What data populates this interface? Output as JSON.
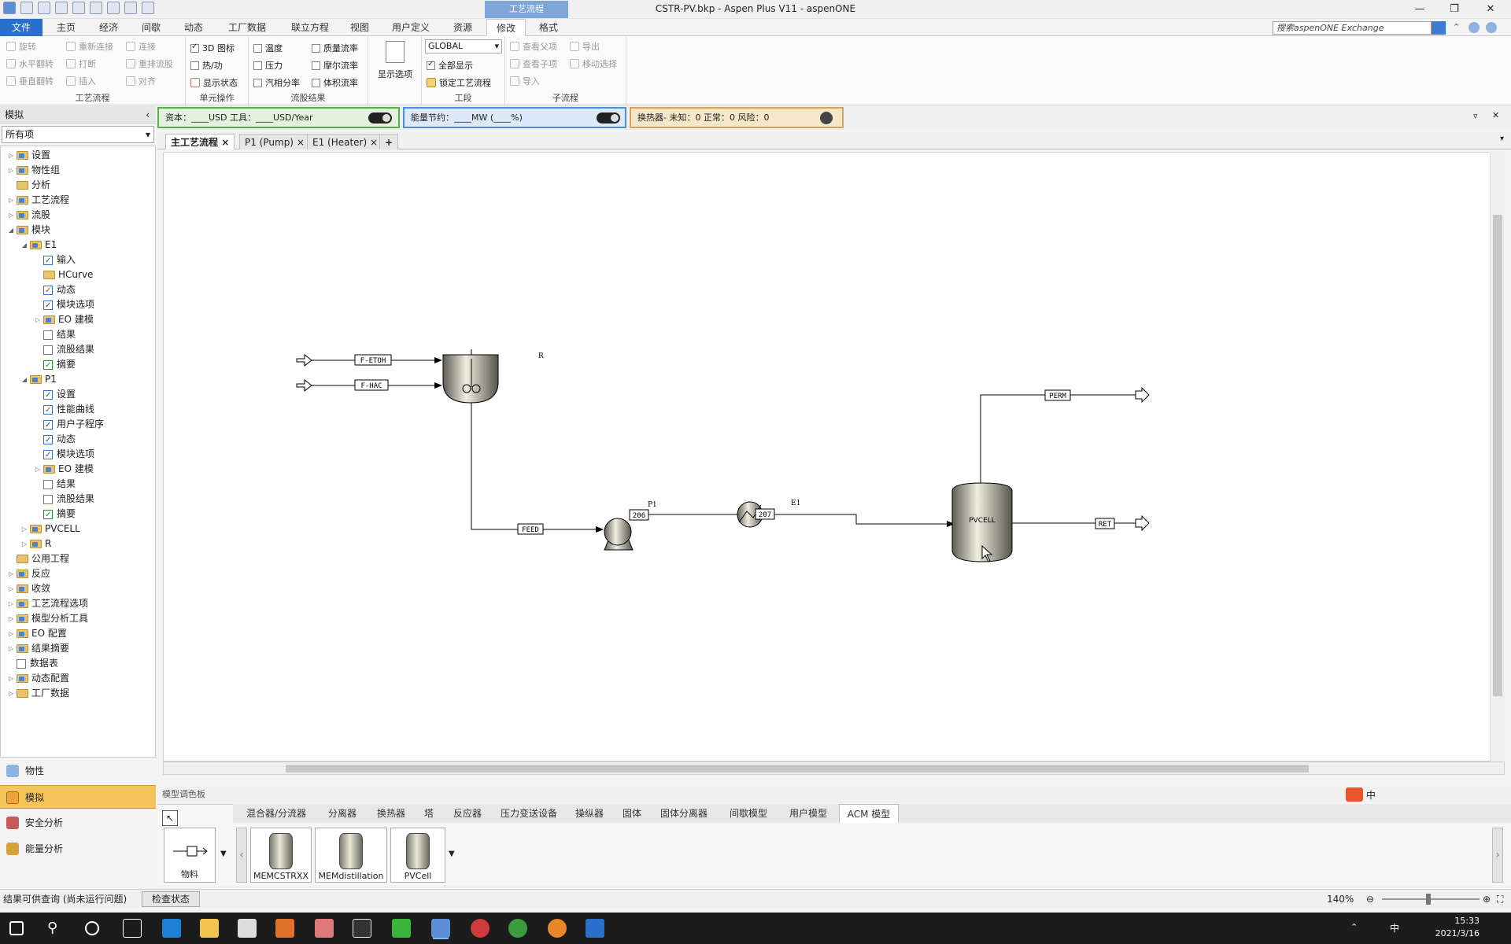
{
  "window": {
    "title": "CSTR-PV.bkp - Aspen Plus V11 - aspenONE",
    "context_tab": "工艺流程"
  },
  "tabs": [
    "文件",
    "主页",
    "经济",
    "间歇",
    "动态",
    "工厂数据",
    "联立方程",
    "视图",
    "用户定义",
    "资源",
    "修改",
    "格式"
  ],
  "search_exchange": "搜索aspenONE Exchange",
  "ribbon": {
    "flowsheet": {
      "items": [
        "旋转",
        "水平翻转",
        "垂直翻转",
        "重新连接",
        "打断",
        "插入",
        "连接",
        "重排流股",
        "对齐"
      ],
      "label": "工艺流程"
    },
    "unitops": {
      "items": [
        "3D 图标",
        "热/功",
        "显示状态"
      ],
      "label": "单元操作"
    },
    "stream": {
      "items": [
        "温度",
        "压力",
        "汽相分率",
        "质量流率",
        "摩尔流率",
        "体积流率"
      ],
      "label": "流股结果"
    },
    "display": {
      "label": "显示选项"
    },
    "section": {
      "select": "GLOBAL",
      "show_all": "全部显示",
      "lock": "锁定工艺流程",
      "label": "工段"
    },
    "subflowsheet": {
      "items": [
        "查看父项",
        "查看子项",
        "导入",
        "导出",
        "移动选择"
      ],
      "label": "子流程"
    }
  },
  "econ": {
    "capital": "资本：____USD   工具：____USD/Year",
    "energy": "能量节约：____MW   (____%)",
    "hx": "换热器- 未知：0   正常：0   风险：0"
  },
  "nav": {
    "title": "模拟",
    "filter": "所有项",
    "tree": [
      {
        "label": "设置",
        "lvl": 0,
        "arrow": "▷",
        "type": "folder-blue"
      },
      {
        "label": "物性组",
        "lvl": 0,
        "arrow": "▷",
        "type": "folder-blue"
      },
      {
        "label": "分析",
        "lvl": 0,
        "arrow": "",
        "type": "folder"
      },
      {
        "label": "工艺流程",
        "lvl": 0,
        "arrow": "▷",
        "type": "folder-blue"
      },
      {
        "label": "流股",
        "lvl": 0,
        "arrow": "▷",
        "type": "folder-blue"
      },
      {
        "label": "模块",
        "lvl": 0,
        "arrow": "◢",
        "type": "folder-blue"
      },
      {
        "label": "E1",
        "lvl": 1,
        "arrow": "◢",
        "type": "folder-blue"
      },
      {
        "label": "输入",
        "lvl": 2,
        "arrow": "",
        "type": "form-ok"
      },
      {
        "label": "HCurve",
        "lvl": 2,
        "arrow": "",
        "type": "folder"
      },
      {
        "label": "动态",
        "lvl": 2,
        "arrow": "",
        "type": "form-ok"
      },
      {
        "label": "模块选项",
        "lvl": 2,
        "arrow": "",
        "type": "form-ok"
      },
      {
        "label": "EO 建模",
        "lvl": 2,
        "arrow": "▷",
        "type": "folder-blue"
      },
      {
        "label": "结果",
        "lvl": 2,
        "arrow": "",
        "type": "form-plain"
      },
      {
        "label": "流股结果",
        "lvl": 2,
        "arrow": "",
        "type": "form-plain"
      },
      {
        "label": "摘要",
        "lvl": 2,
        "arrow": "",
        "type": "form-sum"
      },
      {
        "label": "P1",
        "lvl": 1,
        "arrow": "◢",
        "type": "folder-blue"
      },
      {
        "label": "设置",
        "lvl": 2,
        "arrow": "",
        "type": "form-ok"
      },
      {
        "label": "性能曲线",
        "lvl": 2,
        "arrow": "",
        "type": "form-ok"
      },
      {
        "label": "用户子程序",
        "lvl": 2,
        "arrow": "",
        "type": "form-ok"
      },
      {
        "label": "动态",
        "lvl": 2,
        "arrow": "",
        "type": "form-ok"
      },
      {
        "label": "模块选项",
        "lvl": 2,
        "arrow": "",
        "type": "form-ok"
      },
      {
        "label": "EO 建模",
        "lvl": 2,
        "arrow": "▷",
        "type": "folder-blue"
      },
      {
        "label": "结果",
        "lvl": 2,
        "arrow": "",
        "type": "form-plain"
      },
      {
        "label": "流股结果",
        "lvl": 2,
        "arrow": "",
        "type": "form-plain"
      },
      {
        "label": "摘要",
        "lvl": 2,
        "arrow": "",
        "type": "form-sum"
      },
      {
        "label": "PVCELL",
        "lvl": 1,
        "arrow": "▷",
        "type": "folder-blue"
      },
      {
        "label": "R",
        "lvl": 1,
        "arrow": "▷",
        "type": "folder-blue"
      },
      {
        "label": "公用工程",
        "lvl": 0,
        "arrow": "",
        "type": "folder"
      },
      {
        "label": "反应",
        "lvl": 0,
        "arrow": "▷",
        "type": "folder-blue"
      },
      {
        "label": "收敛",
        "lvl": 0,
        "arrow": "▷",
        "type": "folder-blue"
      },
      {
        "label": "工艺流程选项",
        "lvl": 0,
        "arrow": "▷",
        "type": "folder-blue"
      },
      {
        "label": "模型分析工具",
        "lvl": 0,
        "arrow": "▷",
        "type": "folder-blue"
      },
      {
        "label": "EO 配置",
        "lvl": 0,
        "arrow": "▷",
        "type": "folder-blue"
      },
      {
        "label": "结果摘要",
        "lvl": 0,
        "arrow": "▷",
        "type": "folder-blue"
      },
      {
        "label": "数据表",
        "lvl": 0,
        "arrow": "",
        "type": "form-plain"
      },
      {
        "label": "动态配置",
        "lvl": 0,
        "arrow": "▷",
        "type": "folder-blue"
      },
      {
        "label": "工厂数据",
        "lvl": 0,
        "arrow": "▷",
        "type": "folder"
      }
    ],
    "buttons": [
      "物性",
      "模拟",
      "安全分析",
      "能量分析"
    ]
  },
  "doc_tabs": [
    "主工艺流程",
    "P1 (Pump)",
    "E1 (Heater)"
  ],
  "flowsheet": {
    "streams": [
      "F-ETOH",
      "F-HAC",
      "FEED",
      "206",
      "207",
      "PERM",
      "RET"
    ],
    "blocks": [
      "R",
      "P1",
      "E1",
      "PVCELL"
    ]
  },
  "palette": {
    "title": "模型调色板",
    "tabs": [
      "混合器/分流器",
      "分离器",
      "换热器",
      "塔",
      "反应器",
      "压力变送设备",
      "操纵器",
      "固体",
      "固体分离器",
      "间歇模型",
      "用户模型",
      "ACM 模型"
    ],
    "material": "物料",
    "models": [
      "MEMCSTRXX",
      "MEMdistillation",
      "PVCell"
    ]
  },
  "status": {
    "text": "结果可供查询  (尚未运行问题)",
    "button": "检查状态",
    "zoom": "140%"
  },
  "taskbar": {
    "time": "15:33",
    "date": "2021/3/16",
    "ime": "中"
  }
}
